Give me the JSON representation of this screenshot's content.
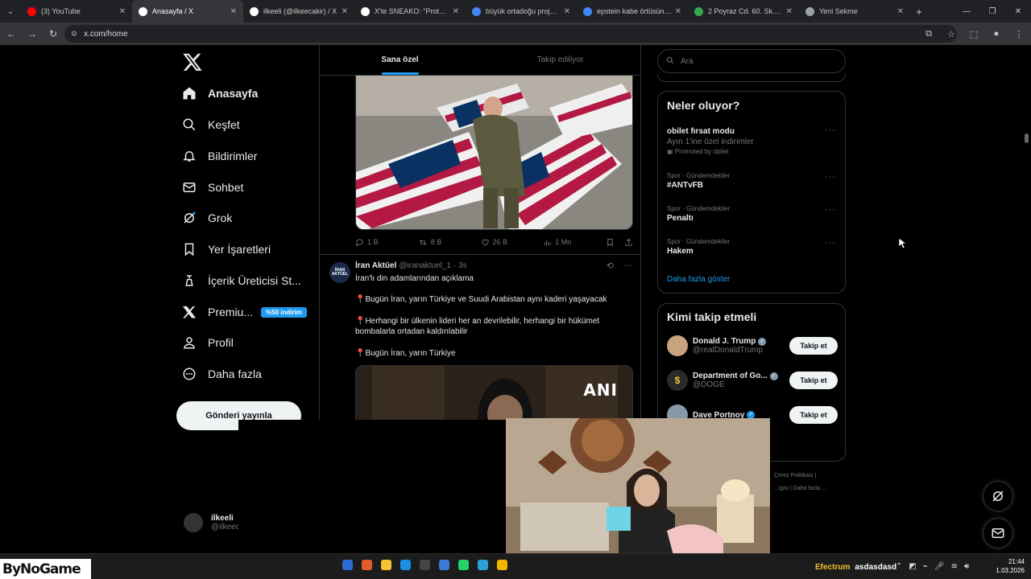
{
  "browser": {
    "tabs": [
      {
        "title": "(3) YouTube",
        "favicon": "youtube-icon",
        "color": "#ff0000"
      },
      {
        "title": "Anasayfa / X",
        "favicon": "x-icon",
        "color": "#ffffff",
        "active": true
      },
      {
        "title": "ilkeeli (@ilkeecakir) / X",
        "favicon": "x-icon",
        "color": "#ffffff"
      },
      {
        "title": "X'te SNEAKO: \"Protect Tur",
        "favicon": "x-icon",
        "color": "#ffffff"
      },
      {
        "title": "büyük ortadoğu projesi h",
        "favicon": "google-icon",
        "color": "#4285f4"
      },
      {
        "title": "epstein kabe örtüsünü kin",
        "favicon": "google-icon",
        "color": "#4285f4"
      },
      {
        "title": "2 Poyraz Cd. 60. Sk. - Goo",
        "favicon": "maps-icon",
        "color": "#34a853"
      },
      {
        "title": "Yeni Sekme",
        "favicon": "chrome-icon",
        "color": "#9aa0a6"
      }
    ],
    "url": "x.com/home"
  },
  "nav": {
    "items": [
      {
        "label": "Anasayfa",
        "icon": "home-icon"
      },
      {
        "label": "Keşfet",
        "icon": "search-icon"
      },
      {
        "label": "Bildirimler",
        "icon": "bell-icon"
      },
      {
        "label": "Sohbet",
        "icon": "mail-icon"
      },
      {
        "label": "Grok",
        "icon": "grok-icon"
      },
      {
        "label": "Yer İşaretleri",
        "icon": "bookmark-icon"
      },
      {
        "label": "İçerik Üreticisi St...",
        "icon": "creator-icon"
      },
      {
        "label": "Premiu...",
        "icon": "x-premium-icon",
        "badge": "%50 indirim"
      },
      {
        "label": "Profil",
        "icon": "profile-icon"
      },
      {
        "label": "Daha fazla",
        "icon": "more-circle-icon"
      }
    ],
    "post_button": "Gönderi yayınla",
    "account": {
      "name": "ilkeeli",
      "handle": "@ilkeec"
    }
  },
  "feed": {
    "tabs": [
      "Sana özel",
      "Takip ediliyor"
    ],
    "tweet1_actions": {
      "replies": "1 B",
      "reposts": "8 B",
      "likes": "26 B",
      "views": "1 Mn"
    },
    "tweet2": {
      "avatar_text": "İRAN AKTÜEL",
      "name": "İran Aktüel",
      "handle": "@iranaktuel_1",
      "time": "· 3s",
      "lines": [
        "İran'lı din adamlarından açıklama",
        "Bugün İran, yarın Türkiye ve Suudi Arabistan aynı kaderi yaşayacak",
        "Herhangi bir ülkenin lideri her an devrilebilir, herhangi bir hükümet bombalarla ortadan kaldırılabilir",
        "Bugün İran, yarın Türkiye"
      ],
      "media_tag": "ANI"
    }
  },
  "sidebar": {
    "search_placeholder": "Ara",
    "whats_happening": {
      "title": "Neler oluyor?",
      "trends": [
        {
          "context": "",
          "name": "obilet fırsat modu",
          "sub": "Ayın 1'ine özel indirimler",
          "promo": "Promoted by obilet"
        },
        {
          "context": "Spor · Gündemdekiler",
          "name": "#ANTvFB",
          "sub": "",
          "promo": ""
        },
        {
          "context": "Spor · Gündemdekiler",
          "name": "Penaltı",
          "sub": "",
          "promo": ""
        },
        {
          "context": "Spor · Gündemdekiler",
          "name": "Hakem",
          "sub": "",
          "promo": ""
        }
      ],
      "show_more": "Daha fazla göster"
    },
    "who_to_follow": {
      "title": "Kimi takip etmeli",
      "accounts": [
        {
          "name": "Donald J. Trump",
          "handle": "@realDonaldTrump",
          "verified_color": "#829aab",
          "avatar_color": "#c9a27e"
        },
        {
          "name": "Department of Go...",
          "handle": "@DOGE",
          "verified_color": "#829aab",
          "avatar_color": "#2a2a2a"
        },
        {
          "name": "Dave Portnoy",
          "handle": "",
          "verified_color": "#1d9bf0",
          "avatar_color": "#8899aa"
        }
      ],
      "follow_label": "Takip et"
    },
    "footer": [
      "Çerez Politikası",
      "|",
      "...igisi",
      "|",
      "Daha fazla ..."
    ]
  },
  "taskbar": {
    "logo": "ByNoGame",
    "tray_labels": [
      "Efectrum",
      "asdasdasd"
    ],
    "time": "21:44",
    "date": "1.03.2026"
  }
}
